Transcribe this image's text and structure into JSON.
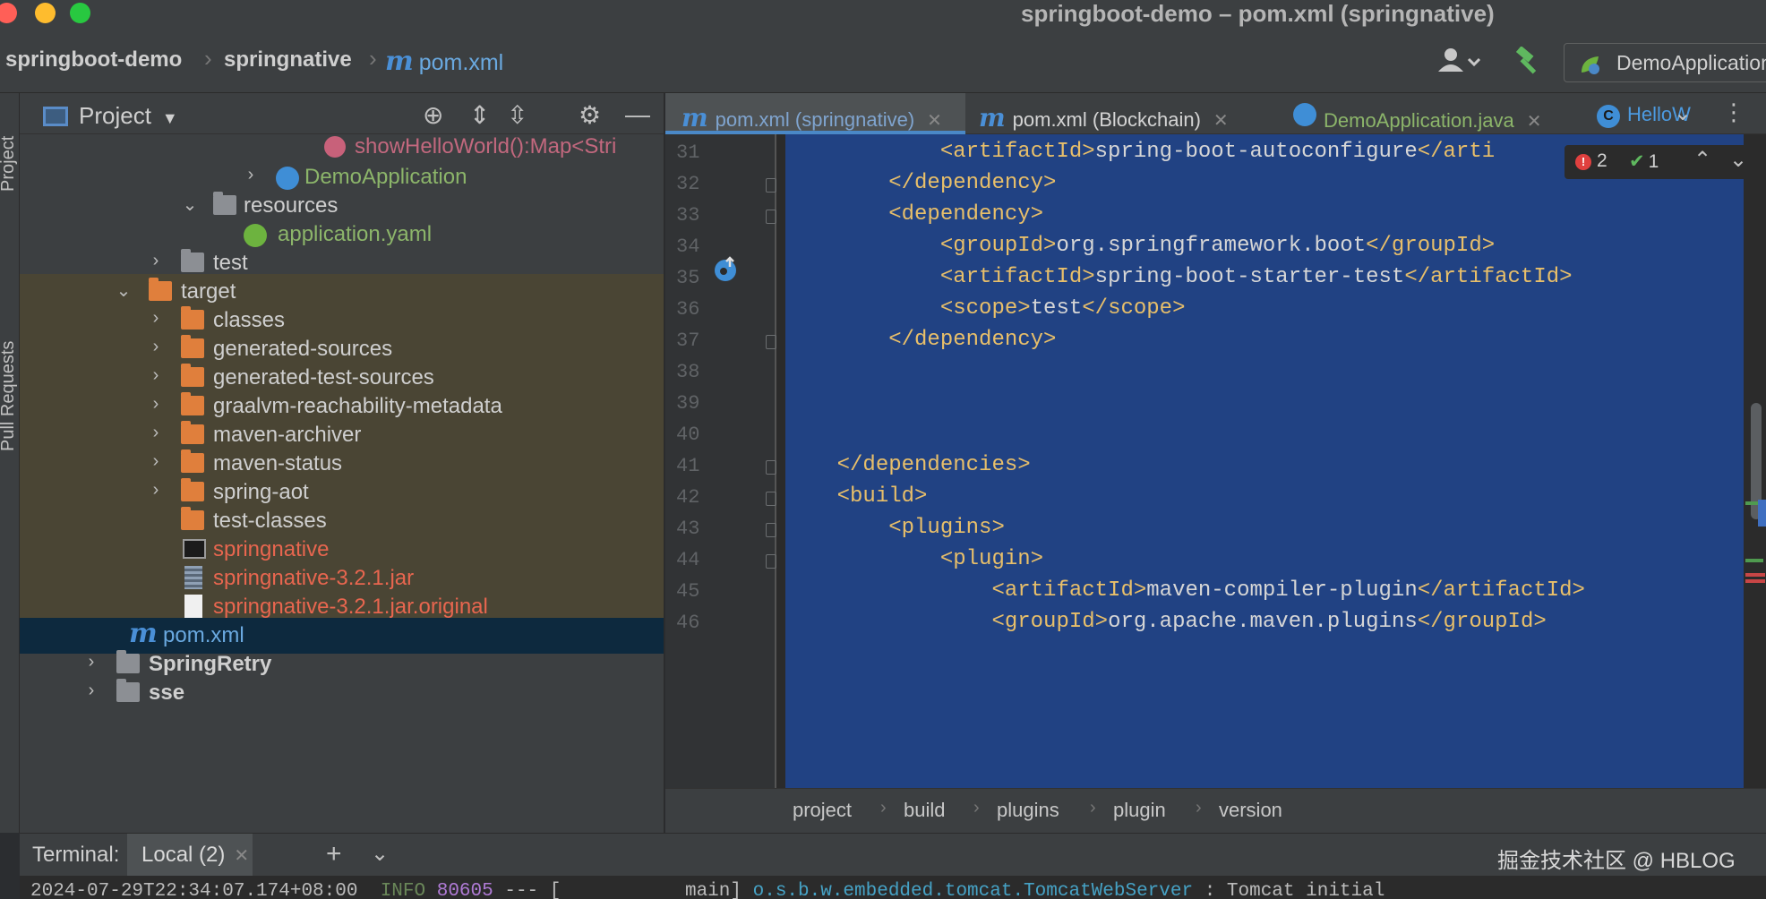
{
  "window": {
    "title": "springboot-demo – pom.xml (springnative)"
  },
  "navbar": {
    "crumbs": [
      "springboot-demo",
      "springnative"
    ],
    "file_label": "pom.xml",
    "run_config": "DemoApplication"
  },
  "tool_strip": {
    "project_tab": "Project",
    "pull_requests_tab": "Pull Requests"
  },
  "project_panel": {
    "title": "Project",
    "rows": [
      {
        "label": "showHelloWorld():Map<Stri",
        "indent": 0
      },
      {
        "label": "DemoApplication"
      },
      {
        "label": "resources"
      },
      {
        "label": "application.yaml"
      },
      {
        "label": "test"
      },
      {
        "label": "target"
      },
      {
        "label": "classes"
      },
      {
        "label": "generated-sources"
      },
      {
        "label": "generated-test-sources"
      },
      {
        "label": "graalvm-reachability-metadata"
      },
      {
        "label": "maven-archiver"
      },
      {
        "label": "maven-status"
      },
      {
        "label": "spring-aot"
      },
      {
        "label": "test-classes"
      },
      {
        "label": "springnative"
      },
      {
        "label": "springnative-3.2.1.jar"
      },
      {
        "label": "springnative-3.2.1.jar.original"
      },
      {
        "label": "pom.xml"
      },
      {
        "label": "SpringRetry"
      },
      {
        "label": "sse"
      }
    ]
  },
  "editor": {
    "tabs": [
      {
        "label": "pom.xml (springnative)"
      },
      {
        "label": "pom.xml (Blockchain)"
      },
      {
        "label": "DemoApplication.java"
      },
      {
        "label": "HelloW"
      }
    ],
    "inspection": {
      "errors": "2",
      "ok": "1"
    },
    "line_numbers": [
      "31",
      "32",
      "33",
      "34",
      "35",
      "36",
      "37",
      "38",
      "39",
      "40",
      "41",
      "42",
      "43",
      "44",
      "45",
      "46"
    ],
    "lines": [
      {
        "indent": "            ",
        "open": "<artifactId>",
        "text": "spring-boot-autoconfigure",
        "close": "</arti"
      },
      {
        "indent": "        ",
        "open": "</dependency>",
        "text": "",
        "close": ""
      },
      {
        "indent": "        ",
        "open": "<dependency>",
        "text": "",
        "close": ""
      },
      {
        "indent": "            ",
        "open": "<groupId>",
        "text": "org.springframework.boot",
        "close": "</groupId>"
      },
      {
        "indent": "            ",
        "open": "<artifactId>",
        "text": "spring-boot-starter-test",
        "close": "</artifactId>"
      },
      {
        "indent": "            ",
        "open": "<scope>",
        "text": "test",
        "close": "</scope>"
      },
      {
        "indent": "        ",
        "open": "</dependency>",
        "text": "",
        "close": ""
      },
      {
        "indent": "",
        "open": "",
        "text": "",
        "close": ""
      },
      {
        "indent": "",
        "open": "",
        "text": "",
        "close": ""
      },
      {
        "indent": "",
        "open": "",
        "text": "",
        "close": ""
      },
      {
        "indent": "    ",
        "open": "</dependencies>",
        "text": "",
        "close": ""
      },
      {
        "indent": "    ",
        "open": "<build>",
        "text": "",
        "close": ""
      },
      {
        "indent": "        ",
        "open": "<plugins>",
        "text": "",
        "close": ""
      },
      {
        "indent": "            ",
        "open": "<plugin>",
        "text": "",
        "close": ""
      },
      {
        "indent": "                ",
        "open": "<artifactId>",
        "text": "maven-compiler-plugin",
        "close": "</artifactId>"
      },
      {
        "indent": "                ",
        "open": "<groupId>",
        "text": "org.apache.maven.plugins",
        "close": "</groupId>"
      }
    ],
    "breadcrumb": [
      "project",
      "build",
      "plugins",
      "plugin",
      "version"
    ]
  },
  "terminal": {
    "label": "Terminal:",
    "tab": "Local (2)",
    "line_date": "2024-07-29T22:34:07.174+08:00",
    "line_level": "INFO",
    "line_pid": "80605",
    "line_thread": "[           main]",
    "line_class": "o.s.b.w.embedded.tomcat.TomcatWebServer",
    "line_msg": " : Tomcat initial"
  },
  "watermark": "掘金技术社区 @ HBLOG",
  "colors": {
    "selection": "#214283",
    "tag": "#e8bf6a",
    "excluded_bg": "#4a4534",
    "accent": "#4a88c7"
  }
}
